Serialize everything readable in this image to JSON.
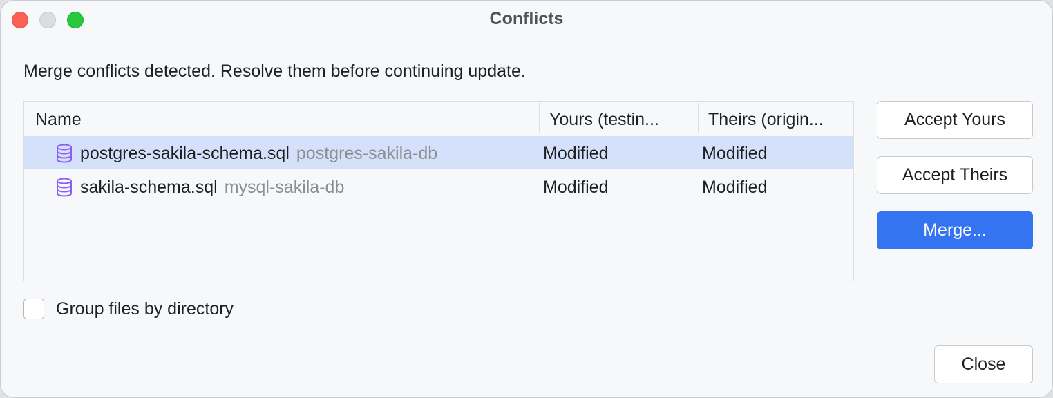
{
  "window": {
    "title": "Conflicts"
  },
  "message": "Merge conflicts detected. Resolve them before continuing update.",
  "table": {
    "columns": [
      "Name",
      "Yours (testin...",
      "Theirs (origin..."
    ],
    "rows": [
      {
        "file": "postgres-sakila-schema.sql",
        "dir": "postgres-sakila-db",
        "yours": "Modified",
        "theirs": "Modified",
        "selected": true,
        "icon": "database-icon"
      },
      {
        "file": "sakila-schema.sql",
        "dir": "mysql-sakila-db",
        "yours": "Modified",
        "theirs": "Modified",
        "selected": false,
        "icon": "database-icon"
      }
    ]
  },
  "buttons": {
    "accept_yours": "Accept Yours",
    "accept_theirs": "Accept Theirs",
    "merge": "Merge...",
    "close": "Close"
  },
  "group_by_directory": {
    "label": "Group files by directory",
    "checked": false
  },
  "colors": {
    "accent": "#3574f0",
    "selection": "#d5e1fb",
    "icon": "#8e5cf6",
    "muted_text": "#8c8e94"
  }
}
